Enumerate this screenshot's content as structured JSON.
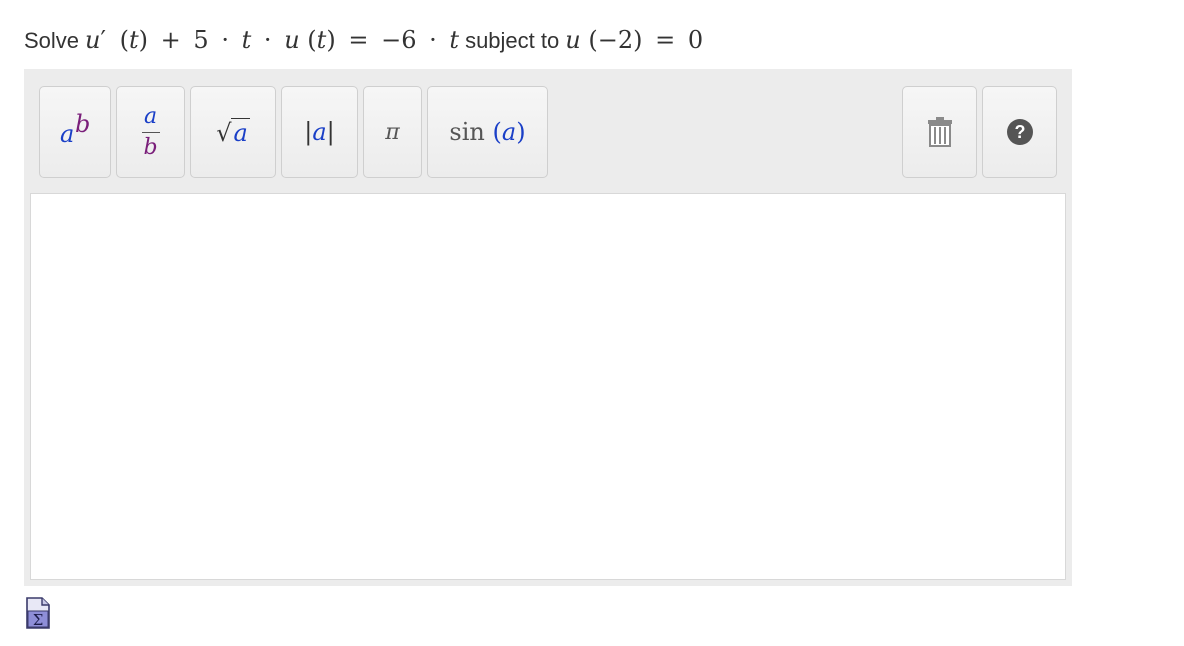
{
  "question": {
    "prefix": "Solve",
    "equation": {
      "lhs_fn": "u",
      "prime": "′",
      "arg_open": "(",
      "arg": "t",
      "arg_close": ")",
      "plus": "+",
      "coef": "5",
      "dot1": "·",
      "var_t1": "t",
      "dot2": "·",
      "u2": "u",
      "arg2_open": "(",
      "arg2": "t",
      "arg2_close": ")",
      "equals": "=",
      "rhs_coef": "−6",
      "dot3": "·",
      "rhs_var": "t"
    },
    "connector": "subject to",
    "condition": {
      "fn": "u",
      "open": "(",
      "arg": "−2",
      "close": ")",
      "equals": "=",
      "value": "0"
    }
  },
  "toolbar": {
    "power": {
      "base": "a",
      "exponent": "b"
    },
    "fraction": {
      "numerator": "a",
      "denominator": "b"
    },
    "sqrt": {
      "radical": "√",
      "radicand": "a"
    },
    "abs": {
      "left_bar": "|",
      "content": "a",
      "right_bar": "|"
    },
    "pi": {
      "symbol": "π"
    },
    "sin": {
      "fn": "sin",
      "open": "(",
      "arg": "a",
      "close": ")"
    },
    "trash_icon": "trash-icon",
    "help_icon": "help-icon"
  },
  "colors": {
    "variable_a": "#1a3fc7",
    "variable_b": "#7a1f7a",
    "panel_bg": "#ececec",
    "help_circle": "#555555"
  },
  "formula_icon": "sigma-document-icon"
}
